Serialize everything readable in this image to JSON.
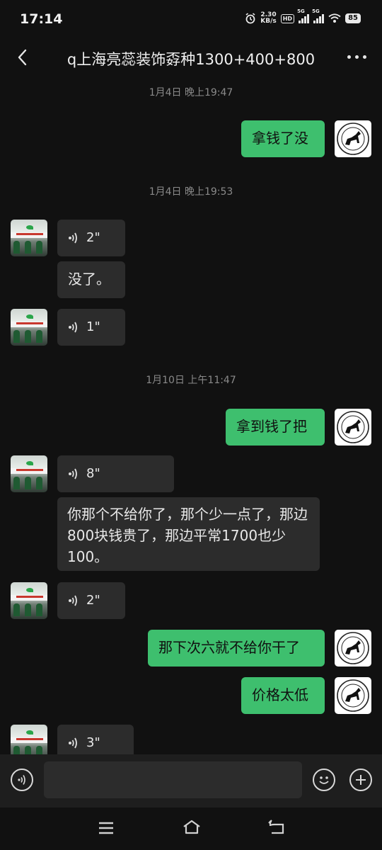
{
  "status_bar": {
    "time": "17:14",
    "net_speed_value": "2.30",
    "net_speed_unit": "KB/s",
    "hd_label": "HD",
    "sim1_label": "5G",
    "sim2_label": "5G",
    "battery": "85"
  },
  "header": {
    "title": "q上海亮蕊装饰孬种1300+400+800"
  },
  "chat": {
    "timestamps": [
      "1月4日 晚上19:47",
      "1月4日 晚上19:53",
      "1月10日 上午11:47"
    ],
    "messages": [
      {
        "from": "me",
        "type": "text",
        "text": "拿钱了没"
      },
      {
        "from": "other",
        "type": "voice",
        "duration": "2\""
      },
      {
        "from": "other",
        "type": "text",
        "text": "没了。"
      },
      {
        "from": "other",
        "type": "voice",
        "duration": "1\""
      },
      {
        "from": "me",
        "type": "text",
        "text": "拿到钱了把"
      },
      {
        "from": "other",
        "type": "voice",
        "duration": "8\""
      },
      {
        "from": "other",
        "type": "text",
        "text": "你那个不给你了，那个少一点了，那边800块钱贵了，那边平常1700也少100。"
      },
      {
        "from": "other",
        "type": "voice",
        "duration": "2\""
      },
      {
        "from": "me",
        "type": "text",
        "text": "那下次六就不给你干了"
      },
      {
        "from": "me",
        "type": "text",
        "text": "价格太低"
      },
      {
        "from": "other",
        "type": "voice",
        "duration": "3\""
      }
    ]
  },
  "input_bar": {
    "placeholder": ""
  },
  "colors": {
    "background": "#111111",
    "incoming_bubble": "#2c2c2c",
    "outgoing_bubble": "#3ebf6e",
    "timestamp_text": "#8a8a8a"
  },
  "icons": {
    "back": "chevron-left-icon",
    "more": "more-horizontal-icon",
    "voice_toggle": "voice-icon",
    "emoji": "emoji-icon",
    "plus": "plus-icon",
    "nav_menu": "menu-icon",
    "nav_home": "home-icon",
    "nav_back": "back-nav-icon"
  }
}
